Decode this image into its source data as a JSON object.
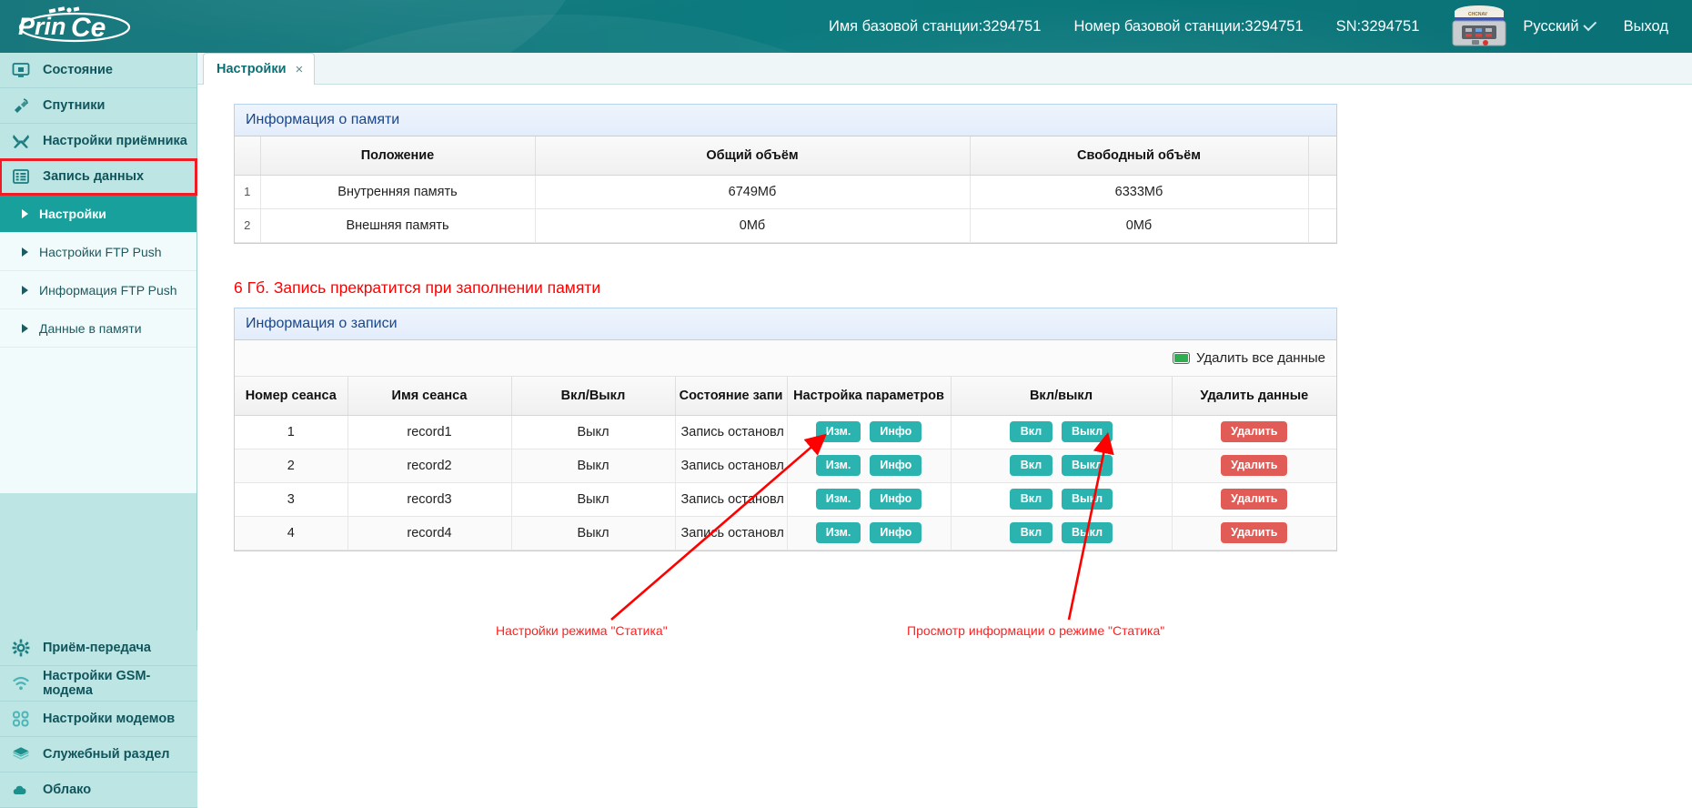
{
  "header": {
    "logo_text": "PrinCe",
    "station_name_label": "Имя базовой станции:3294751",
    "station_number_label": "Номер базовой станции:3294751",
    "sn_label": "SN:3294751",
    "language": "Русский",
    "logout": "Выход",
    "device_icon": "gnss-receiver-icon"
  },
  "sidebar": {
    "items": [
      {
        "label": "Состояние",
        "icon": "monitor-icon"
      },
      {
        "label": "Спутники",
        "icon": "satellite-icon"
      },
      {
        "label": "Настройки приёмника",
        "icon": "wrench-icon"
      },
      {
        "label": "Запись данных",
        "icon": "list-icon",
        "selected": true
      }
    ],
    "sub_items": [
      {
        "label": "Настройки",
        "active": true
      },
      {
        "label": "Настройки FTP Push",
        "active": false
      },
      {
        "label": "Информация FTP Push",
        "active": false
      },
      {
        "label": "Данные в памяти",
        "active": false
      }
    ],
    "bottom_items": [
      {
        "label": "Приём-передача поправок",
        "icon": "gear-icon"
      },
      {
        "label": "Настройки GSM-модема",
        "icon": "wifi-icon"
      },
      {
        "label": "Настройки модемов",
        "icon": "grid-icon"
      },
      {
        "label": "Служебный раздел",
        "icon": "layers-icon"
      },
      {
        "label": "Облако",
        "icon": "cloud-icon"
      }
    ]
  },
  "tabs": [
    {
      "label": "Настройки",
      "close": "×",
      "active": true
    }
  ],
  "memory_panel": {
    "title": "Информация о памяти",
    "columns": [
      "",
      "Положение",
      "Общий объём",
      "Свободный объём",
      ""
    ],
    "rows": [
      {
        "index": "1",
        "location": "Внутренняя память",
        "total": "6749Мб",
        "free": "6333Мб"
      },
      {
        "index": "2",
        "location": "Внешняя память",
        "total": "0Мб",
        "free": "0Мб"
      }
    ]
  },
  "warning": "6 Гб. Запись прекратится при заполнении памяти",
  "record_panel": {
    "title": "Информация о записи",
    "delete_all_label": "Удалить все данные",
    "columns": [
      "Номер сеанса",
      "Имя сеанса",
      "Вкл/Выкл",
      "Состояние запи",
      "Настройка параметров",
      "Вкл/выкл",
      "Удалить данные"
    ],
    "buttons": {
      "edit": "Изм.",
      "info": "Инфо",
      "on": "Вкл",
      "off": "Выкл",
      "delete": "Удалить"
    },
    "rows": [
      {
        "session_number": "1",
        "session_name": "record1",
        "on_off": "Выкл",
        "state": "Запись остановл"
      },
      {
        "session_number": "2",
        "session_name": "record2",
        "on_off": "Выкл",
        "state": "Запись остановл"
      },
      {
        "session_number": "3",
        "session_name": "record3",
        "on_off": "Выкл",
        "state": "Запись остановл"
      },
      {
        "session_number": "4",
        "session_name": "record4",
        "on_off": "Выкл",
        "state": "Запись остановл"
      }
    ]
  },
  "annotations": [
    {
      "text": "Настройки режима \"Статика\""
    },
    {
      "text": "Просмотр информации о режиме \"Статика\""
    }
  ],
  "colors": {
    "header_teal": "#0b7378",
    "sidebar_bg": "#bde5e4",
    "active_sub": "#17a09c",
    "btn_teal": "#2bb3b0",
    "btn_red": "#e15c57",
    "warning_red": "#ff0000",
    "panel_title": "#18478c",
    "highlight_outline": "#ee1c25"
  }
}
